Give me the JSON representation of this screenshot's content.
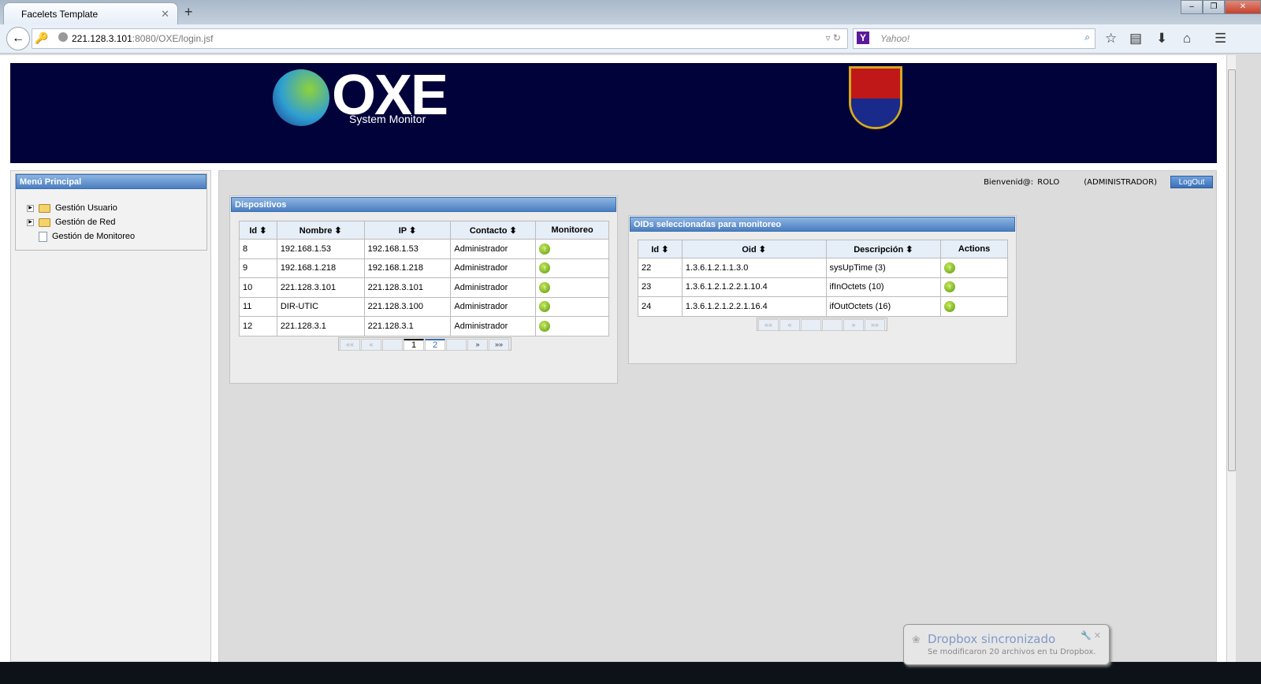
{
  "browser": {
    "tab_title": "Facelets Template",
    "url_host": "221.128.3.101",
    "url_rest": ":8080/OXE/login.jsf",
    "search_placeholder": "Yahoo!",
    "search_engine_letter": "Y"
  },
  "banner": {
    "logo_text": "OXE",
    "logo_subtitle": "System Monitor"
  },
  "sidebar": {
    "title": "Menú Principal",
    "items": [
      {
        "label": "Gestión Usuario",
        "icon": "folder-icon"
      },
      {
        "label": "Gestión de Red",
        "icon": "folder-icon"
      },
      {
        "label": "Gestión de Monitoreo",
        "icon": "document-icon"
      }
    ]
  },
  "user": {
    "welcome": "Bienvenid@:",
    "name": "ROLO",
    "role": "(ADMINISTRADOR)",
    "logout": "LogOut"
  },
  "devices": {
    "title": "Dispositivos",
    "columns": [
      "Id",
      "Nombre",
      "IP",
      "Contacto",
      "Monitoreo"
    ],
    "rows": [
      [
        "8",
        "192.168.1.53",
        "192.168.1.53",
        "Administrador"
      ],
      [
        "9",
        "192.168.1.218",
        "192.168.1.218",
        "Administrador"
      ],
      [
        "10",
        "221.128.3.101",
        "221.128.3.101",
        "Administrador"
      ],
      [
        "11",
        "DIR-UTIC",
        "221.128.3.100",
        "Administrador"
      ],
      [
        "12",
        "221.128.3.1",
        "221.128.3.1",
        "Administrador"
      ]
    ],
    "pager": {
      "first": "««",
      "prev": "«",
      "pages": [
        "1",
        "2"
      ],
      "next": "»",
      "last": "»»",
      "current": "1"
    }
  },
  "oids": {
    "title": "OIDs seleccionadas para monitoreo",
    "columns": [
      "Id",
      "Oid",
      "Descripción",
      "Actions"
    ],
    "rows": [
      [
        "22",
        "1.3.6.1.2.1.1.3.0",
        "sysUpTime (3)"
      ],
      [
        "23",
        "1.3.6.1.2.1.2.2.1.10.4",
        "ifInOctets (10)"
      ],
      [
        "24",
        "1.3.6.1.2.1.2.2.1.16.4",
        "ifOutOctets (16)"
      ]
    ],
    "pager": {
      "first": "««",
      "prev": "«",
      "next": "»",
      "last": "»»"
    }
  },
  "notification": {
    "title": "Dropbox sincronizado",
    "message": "Se modificaron 20 archivos en tu Dropbox."
  },
  "colors": {
    "banner": "#02023a",
    "panel_header": "#4b7ec0",
    "ok": "#5a9a10"
  }
}
